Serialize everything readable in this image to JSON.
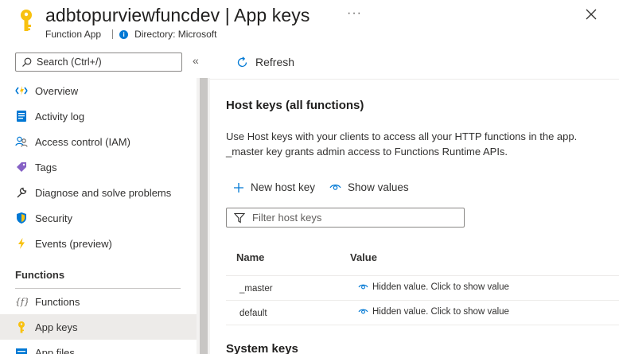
{
  "header": {
    "title": "adbtopurviewfuncdev | App keys",
    "subtitle": "Function App",
    "directory": "Directory: Microsoft",
    "more_label": "···"
  },
  "sidebar": {
    "search_placeholder": "Search (Ctrl+/)",
    "collapse_label": "«",
    "items": [
      {
        "label": "Overview",
        "icon": "function-app-icon"
      },
      {
        "label": "Activity log",
        "icon": "activity-log-icon"
      },
      {
        "label": "Access control (IAM)",
        "icon": "people-icon"
      },
      {
        "label": "Tags",
        "icon": "tag-icon"
      },
      {
        "label": "Diagnose and solve problems",
        "icon": "wrench-icon"
      },
      {
        "label": "Security",
        "icon": "shield-icon"
      },
      {
        "label": "Events (preview)",
        "icon": "lightning-icon"
      }
    ],
    "section_label": "Functions",
    "section_items": [
      {
        "label": "Functions",
        "icon": "function-braces-icon"
      },
      {
        "label": "App keys",
        "icon": "key-icon",
        "active": true
      },
      {
        "label": "App files",
        "icon": "app-files-icon"
      }
    ]
  },
  "command_bar": {
    "refresh_label": "Refresh"
  },
  "host_keys": {
    "heading": "Host keys (all functions)",
    "desc_line1": "Use Host keys with your clients to access all your HTTP functions in the app.",
    "desc_line2": "_master key grants admin access to Functions Runtime APIs.",
    "new_key_label": "New host key",
    "show_values_label": "Show values",
    "filter_placeholder": "Filter host keys",
    "columns": [
      "Name",
      "Value"
    ],
    "rows": [
      {
        "name": "_master",
        "value": "Hidden value. Click to show value"
      },
      {
        "name": "default",
        "value": "Hidden value. Click to show value"
      }
    ]
  },
  "system_keys": {
    "heading": "System keys"
  },
  "colors": {
    "accent": "#0078d4",
    "key_yellow": "#f8c110",
    "active_bg": "#edebe9"
  }
}
